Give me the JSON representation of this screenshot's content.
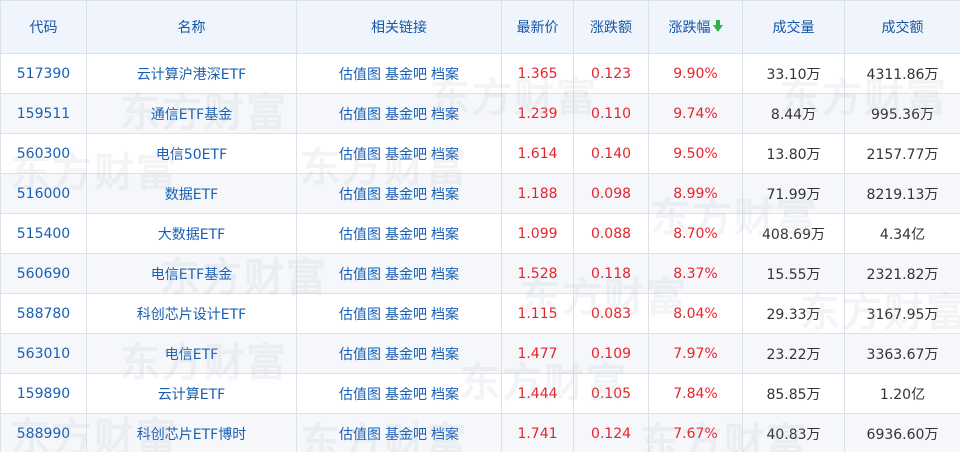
{
  "headers": [
    "代码",
    "名称",
    "相关链接",
    "最新价",
    "涨跌额",
    "涨跌幅",
    "成交量",
    "成交额"
  ],
  "link_labels": [
    "估值图",
    "基金吧",
    "档案"
  ],
  "watermark_text": "东方财富",
  "colors": {
    "header_bg": "#f0f5fd",
    "link": "#1a5fb4",
    "up_red": "#e8242b",
    "sort_green": "#2db34a"
  },
  "rows": [
    {
      "code": "517390",
      "name": "云计算沪港深ETF",
      "price": "1.365",
      "change": "0.123",
      "pct": "9.90%",
      "volume": "33.10万",
      "amount": "4311.86万"
    },
    {
      "code": "159511",
      "name": "通信ETF基金",
      "price": "1.239",
      "change": "0.110",
      "pct": "9.74%",
      "volume": "8.44万",
      "amount": "995.36万"
    },
    {
      "code": "560300",
      "name": "电信50ETF",
      "price": "1.614",
      "change": "0.140",
      "pct": "9.50%",
      "volume": "13.80万",
      "amount": "2157.77万"
    },
    {
      "code": "516000",
      "name": "数据ETF",
      "price": "1.188",
      "change": "0.098",
      "pct": "8.99%",
      "volume": "71.99万",
      "amount": "8219.13万"
    },
    {
      "code": "515400",
      "name": "大数据ETF",
      "price": "1.099",
      "change": "0.088",
      "pct": "8.70%",
      "volume": "408.69万",
      "amount": "4.34亿"
    },
    {
      "code": "560690",
      "name": "电信ETF基金",
      "price": "1.528",
      "change": "0.118",
      "pct": "8.37%",
      "volume": "15.55万",
      "amount": "2321.82万"
    },
    {
      "code": "588780",
      "name": "科创芯片设计ETF",
      "price": "1.115",
      "change": "0.083",
      "pct": "8.04%",
      "volume": "29.33万",
      "amount": "3167.95万"
    },
    {
      "code": "563010",
      "name": "电信ETF",
      "price": "1.477",
      "change": "0.109",
      "pct": "7.97%",
      "volume": "23.22万",
      "amount": "3363.67万"
    },
    {
      "code": "159890",
      "name": "云计算ETF",
      "price": "1.444",
      "change": "0.105",
      "pct": "7.84%",
      "volume": "85.85万",
      "amount": "1.20亿"
    },
    {
      "code": "588990",
      "name": "科创芯片ETF博时",
      "price": "1.741",
      "change": "0.124",
      "pct": "7.67%",
      "volume": "40.83万",
      "amount": "6936.60万"
    }
  ]
}
